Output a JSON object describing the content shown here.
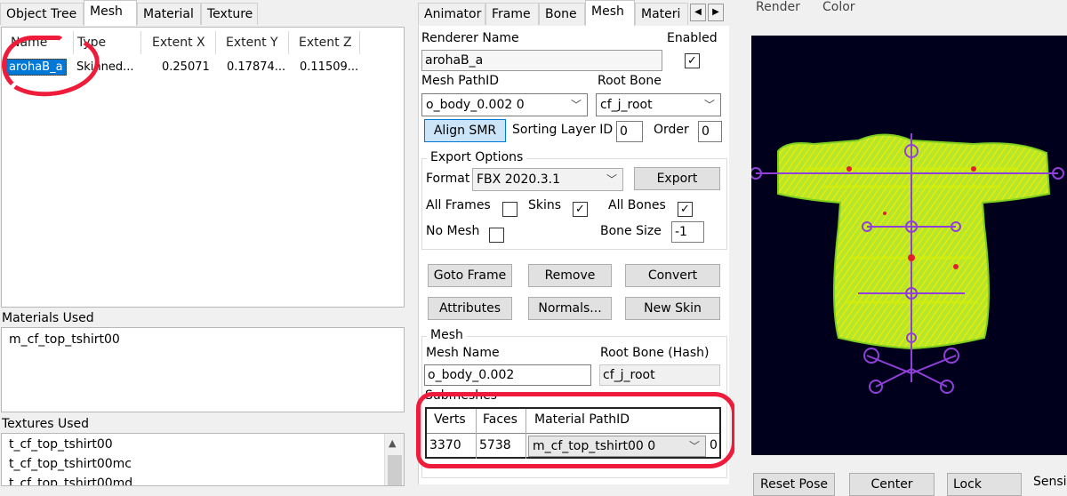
{
  "left_tabs": [
    "Object Tree",
    "Mesh",
    "Material",
    "Texture"
  ],
  "mesh_list": {
    "columns": [
      "Name",
      "Type",
      "Extent X",
      "Extent Y",
      "Extent Z"
    ],
    "row": {
      "name": "arohaB_a",
      "type": "Skinned...",
      "ext_x": "0.25071",
      "ext_y": "0.17874...",
      "ext_z": "0.11509..."
    }
  },
  "materials_used": {
    "label": "Materials Used",
    "items": [
      "m_cf_top_tshirt00"
    ]
  },
  "textures_used": {
    "label": "Textures Used",
    "items": [
      "t_cf_top_tshirt00",
      "t_cf_top_tshirt00mc",
      "t_cf_top_tshirt00md"
    ]
  },
  "mid_tabs": [
    "Animator",
    "Frame",
    "Bone",
    "Mesh",
    "Materi"
  ],
  "renderer": {
    "name_label": "Renderer Name",
    "name_value": "arohaB_a",
    "enabled_label": "Enabled",
    "enabled_checked": "✓",
    "mesh_pathid_label": "Mesh PathID",
    "mesh_pathid_value": "o_body_0.002 0",
    "root_bone_label": "Root Bone",
    "root_bone_value": "cf_j_root",
    "align_btn": "Align SMR",
    "sorting_label": "Sorting Layer ID",
    "sorting_value": "0",
    "order_label": "Order",
    "order_value": "0"
  },
  "export": {
    "group_label": "Export Options",
    "format_label": "Format",
    "format_value": "FBX 2020.3.1",
    "export_btn": "Export",
    "all_frames_label": "All Frames",
    "skins_label": "Skins",
    "skins_checked": "✓",
    "all_bones_label": "All Bones",
    "all_bones_checked": "✓",
    "no_mesh_label": "No Mesh",
    "bone_size_label": "Bone Size",
    "bone_size_value": "-1"
  },
  "actions": {
    "goto_frame": "Goto Frame",
    "remove": "Remove",
    "convert": "Convert",
    "attributes": "Attributes",
    "normals": "Normals...",
    "new_skin": "New Skin"
  },
  "mesh_group": {
    "group_label": "Mesh",
    "mesh_name_label": "Mesh Name",
    "mesh_name_value": "o_body_0.002",
    "root_bone_hash_label": "Root Bone (Hash)",
    "root_bone_hash_value": "cf_j_root",
    "submeshes_label": "Submeshes",
    "columns": [
      "Verts",
      "Faces",
      "Material PathID"
    ],
    "row": {
      "verts": "3370",
      "faces": "5738",
      "material": "m_cf_top_tshirt00 0",
      "extra": "0"
    }
  },
  "right_menu": [
    "Render",
    "Color"
  ],
  "bottom_buttons": [
    "Reset Pose",
    "Center",
    "Lock",
    "Sensi"
  ]
}
